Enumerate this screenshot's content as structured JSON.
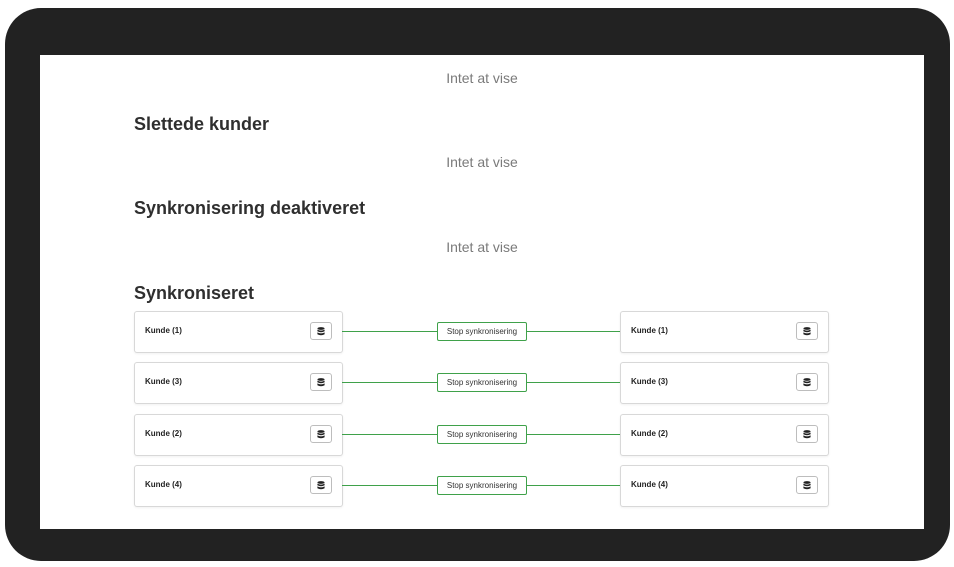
{
  "sections": {
    "top_empty": "Intet at vise",
    "deleted": {
      "heading": "Slettede kunder",
      "empty": "Intet at vise"
    },
    "disabled": {
      "heading": "Synkronisering deaktiveret",
      "empty": "Intet at vise"
    },
    "synced": {
      "heading": "Synkroniseret",
      "rows": [
        {
          "left": "Kunde (1)",
          "action": "Stop synkronisering",
          "right": "Kunde (1)"
        },
        {
          "left": "Kunde (3)",
          "action": "Stop synkronisering",
          "right": "Kunde (3)"
        },
        {
          "left": "Kunde (2)",
          "action": "Stop synkronisering",
          "right": "Kunde (2)"
        },
        {
          "left": "Kunde (4)",
          "action": "Stop synkronisering",
          "right": "Kunde (4)"
        }
      ]
    }
  },
  "icons": {
    "database": "database-icon"
  },
  "colors": {
    "sync_line": "#3fa14a",
    "frame": "#222222"
  }
}
